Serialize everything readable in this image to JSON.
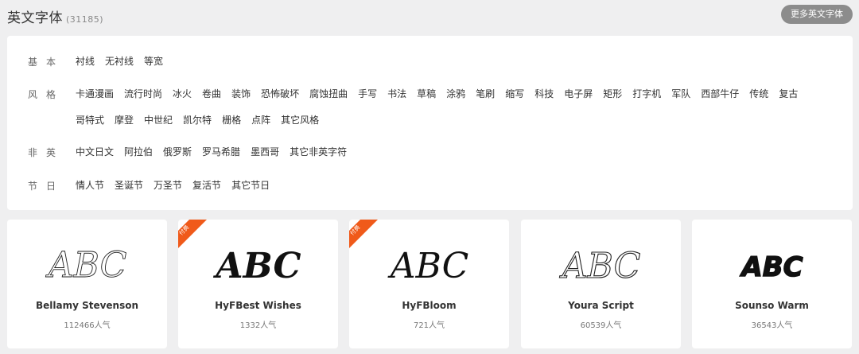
{
  "header": {
    "title": "英文字体",
    "count": "(31185)",
    "more_label": "更多英文字体"
  },
  "filters": [
    {
      "label": "基本",
      "items": [
        "衬线",
        "无衬线",
        "等宽"
      ]
    },
    {
      "label": "风格",
      "items": [
        "卡通漫画",
        "流行时尚",
        "冰火",
        "卷曲",
        "装饰",
        "恐怖破坏",
        "腐蚀扭曲",
        "手写",
        "书法",
        "草稿",
        "涂鸦",
        "笔刷",
        "缩写",
        "科技",
        "电子屏",
        "矩形",
        "打字机",
        "军队",
        "西部牛仔",
        "传统",
        "复古",
        "哥特式",
        "摩登",
        "中世纪",
        "凯尔特",
        "栅格",
        "点阵",
        "其它风格"
      ]
    },
    {
      "label": "非英",
      "items": [
        "中文日文",
        "阿拉伯",
        "俄罗斯",
        "罗马希腊",
        "墨西哥",
        "其它非英字符"
      ]
    },
    {
      "label": "节日",
      "items": [
        "情人节",
        "圣诞节",
        "万圣节",
        "复活节",
        "其它节日"
      ]
    }
  ],
  "cards": [
    {
      "name": "Bellamy Stevenson",
      "popularity": "112466人气",
      "sample": "ABC",
      "badge": ""
    },
    {
      "name": "HyFBest Wishes",
      "popularity": "1332人气",
      "sample": "ABC",
      "badge": "付费"
    },
    {
      "name": "HyFBloom",
      "popularity": "721人气",
      "sample": "ABC",
      "badge": "付费"
    },
    {
      "name": "Youra Script",
      "popularity": "60539人气",
      "sample": "ABC",
      "badge": ""
    },
    {
      "name": "Sounso Warm",
      "popularity": "36543人气",
      "sample": "ABC",
      "badge": ""
    }
  ],
  "colors": {
    "badge": "#f05a1a",
    "more_button": "#8c8c8c",
    "background": "#efeff0"
  }
}
